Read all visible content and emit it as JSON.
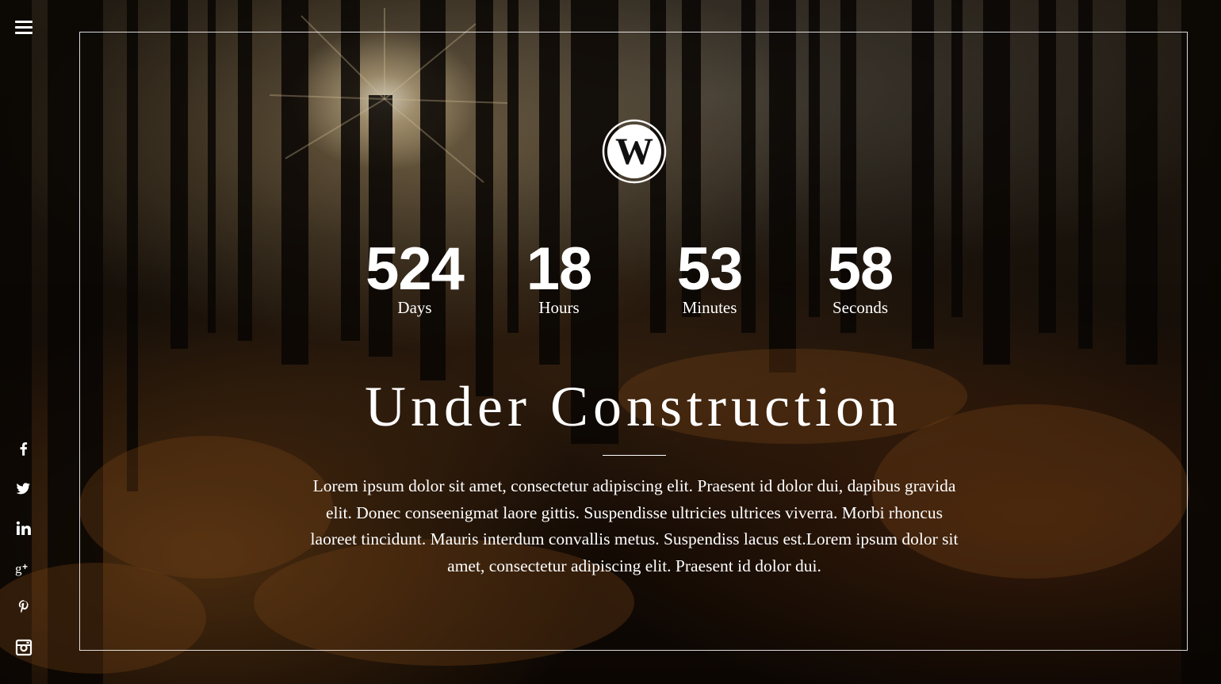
{
  "menu": {
    "icon": "hamburger-menu-icon"
  },
  "logo": {
    "icon": "wordpress-logo"
  },
  "countdown": {
    "days": {
      "value": "524",
      "label": "Days"
    },
    "hours": {
      "value": "18",
      "label": "Hours"
    },
    "minutes": {
      "value": "53",
      "label": "Minutes"
    },
    "seconds": {
      "value": "58",
      "label": "Seconds"
    }
  },
  "headline": "Under Construction",
  "description": "Lorem ipsum dolor sit amet, consectetur adipiscing elit. Praesent id dolor dui, dapibus gravida elit. Donec conseenigmat laore gittis. Suspendisse ultricies ultrices viverra. Morbi rhoncus laoreet tincidunt. Mauris interdum convallis metus. Suspendiss lacus est.Lorem ipsum dolor sit amet, consectetur adipiscing elit. Praesent id dolor dui.",
  "social": [
    {
      "name": "facebook",
      "icon": "facebook-icon"
    },
    {
      "name": "twitter",
      "icon": "twitter-icon"
    },
    {
      "name": "linkedin",
      "icon": "linkedin-icon"
    },
    {
      "name": "google-plus",
      "icon": "google-plus-icon"
    },
    {
      "name": "pinterest",
      "icon": "pinterest-icon"
    },
    {
      "name": "instagram",
      "icon": "instagram-icon"
    }
  ],
  "colors": {
    "text": "#ffffff",
    "frame": "#ffffff",
    "background": "#1a0f07"
  }
}
